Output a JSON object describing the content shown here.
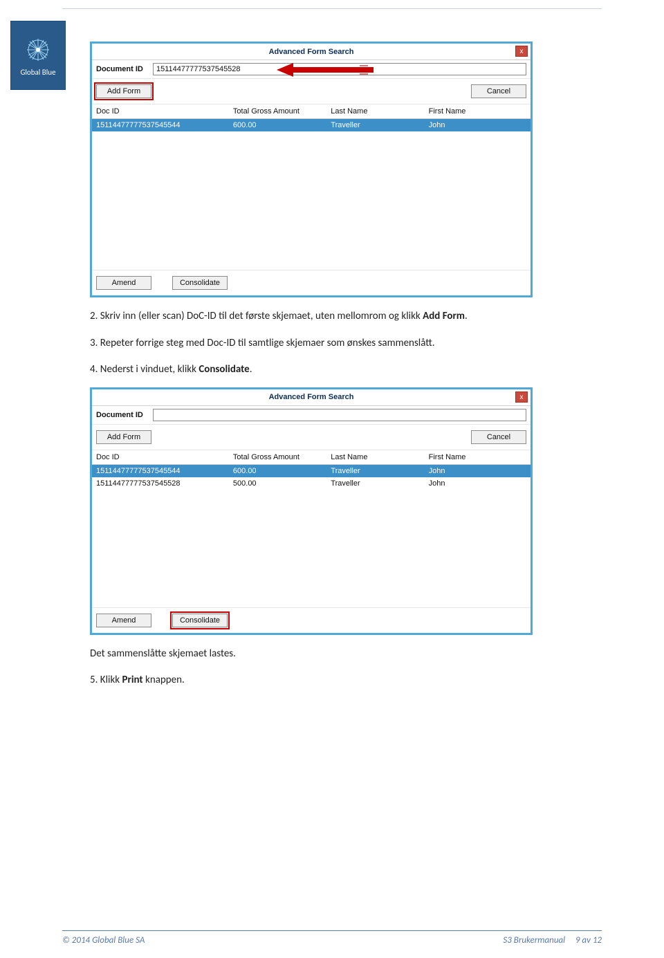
{
  "logo": {
    "text": "Global Blue"
  },
  "dialog1": {
    "title": "Advanced Form Search",
    "close": "x",
    "doc_label": "Document ID",
    "doc_value": "15114477777537545528",
    "add_form": "Add Form",
    "cancel": "Cancel",
    "headers": {
      "c0": "Doc ID",
      "c1": "Total Gross Amount",
      "c2": "Last Name",
      "c3": "First Name"
    },
    "rows": [
      {
        "c0": "15114477777537545544",
        "c1": "600.00",
        "c2": "Traveller",
        "c3": "John"
      }
    ],
    "amend": "Amend",
    "consolidate": "Consolidate"
  },
  "dialog2": {
    "title": "Advanced Form Search",
    "close": "x",
    "doc_label": "Document ID",
    "doc_value": "",
    "add_form": "Add Form",
    "cancel": "Cancel",
    "headers": {
      "c0": "Doc ID",
      "c1": "Total Gross Amount",
      "c2": "Last Name",
      "c3": "First Name"
    },
    "rows": [
      {
        "c0": "15114477777537545544",
        "c1": "600.00",
        "c2": "Traveller",
        "c3": "John"
      },
      {
        "c0": "15114477777537545528",
        "c1": "500.00",
        "c2": "Traveller",
        "c3": "John"
      }
    ],
    "amend": "Amend",
    "consolidate": "Consolidate"
  },
  "step2": {
    "num": "2.",
    "text_a": "Skriv inn (eller scan) DoC-ID til det første skjemaet, uten mellomrom og klikk ",
    "bold": "Add Form",
    "text_b": "."
  },
  "step3": {
    "num": "3.",
    "text": "Repeter forrige steg med Doc-ID til samtlige skjemaer som ønskes sammenslått."
  },
  "step4": {
    "num": "4.",
    "text_a": "Nederst i vinduet, klikk ",
    "bold": "Consolidate",
    "text_b": "."
  },
  "post": {
    "text": "Det sammenslåtte skjemaet lastes."
  },
  "step5": {
    "num": "5.",
    "text_a": "Klikk ",
    "bold": "Print",
    "text_b": " knappen."
  },
  "footer": {
    "left": "© 2014 Global Blue SA",
    "center": "S3 Brukermanual",
    "right": "9 av 12"
  }
}
